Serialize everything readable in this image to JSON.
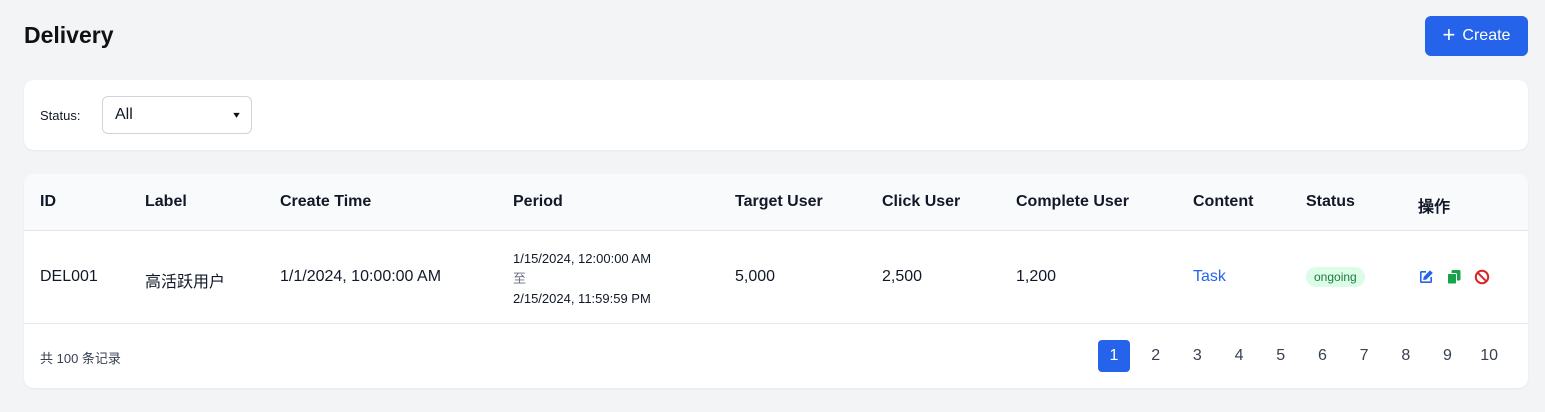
{
  "header": {
    "title": "Delivery",
    "create_label": "Create"
  },
  "filter": {
    "status_label": "Status:",
    "status_value": "All"
  },
  "table": {
    "columns": [
      "ID",
      "Label",
      "Create Time",
      "Period",
      "Target User",
      "Click User",
      "Complete User",
      "Content",
      "Status",
      "操作"
    ],
    "rows": [
      {
        "id": "DEL001",
        "label": "高活跃用户",
        "create_time": "1/1/2024, 10:00:00 AM",
        "period_start": "1/15/2024, 12:00:00 AM",
        "period_sep": "至",
        "period_end": "2/15/2024, 11:59:59 PM",
        "target_user": "5,000",
        "click_user": "2,500",
        "complete_user": "1,200",
        "content": "Task",
        "status": "ongoing",
        "actions": [
          "edit-icon",
          "copy-icon",
          "disable-icon"
        ]
      }
    ]
  },
  "pagination": {
    "total_text": "共 100 条记录",
    "pages": [
      "1",
      "2",
      "3",
      "4",
      "5",
      "6",
      "7",
      "8",
      "9",
      "10"
    ],
    "current": "1"
  },
  "colors": {
    "primary": "#2563eb",
    "status_ongoing_bg": "#dcfce7",
    "status_ongoing_text": "#15803d",
    "copy_icon": "#16a34a",
    "disable_icon": "#dc2626"
  }
}
